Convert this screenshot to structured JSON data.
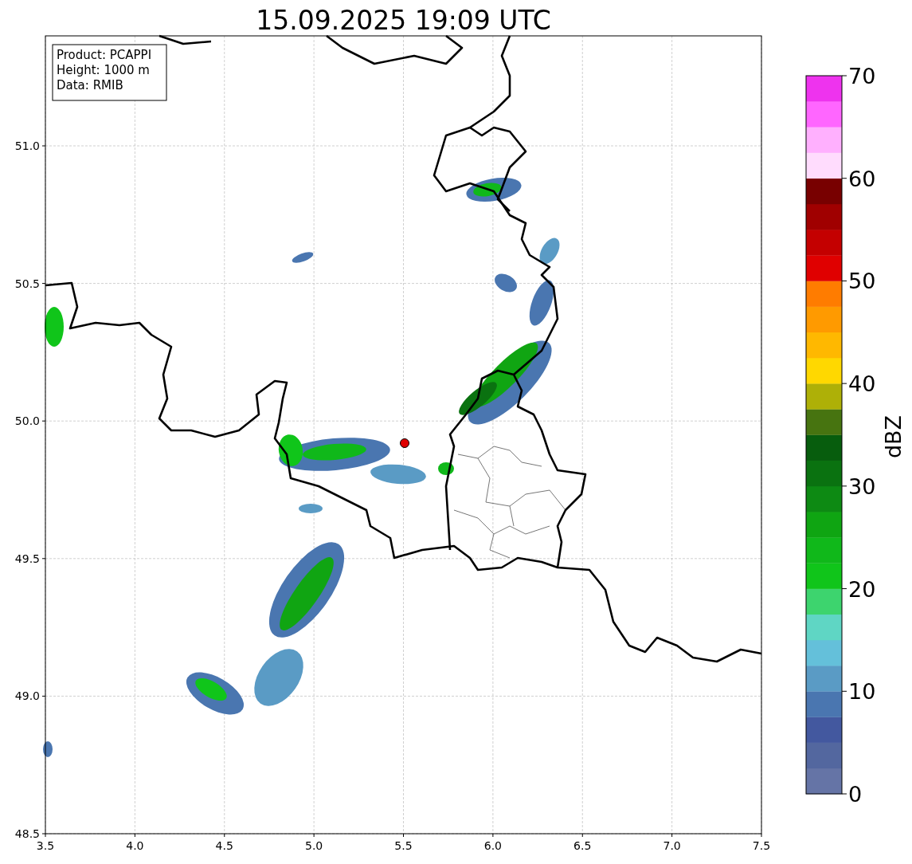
{
  "title": "15.09.2025 19:09 UTC",
  "info_box": [
    "Product: PCAPPI",
    "Height: 1000 m",
    "Data: RMIB"
  ],
  "map": {
    "x_ticks": [
      "3.5",
      "4.0",
      "4.5",
      "5.0",
      "5.5",
      "6.0",
      "6.5",
      "7.0",
      "7.5"
    ],
    "y_ticks": [
      "51.0",
      "50.5",
      "50.0",
      "49.5",
      "49.0",
      "48.5"
    ]
  },
  "colorbar": {
    "label": "dBZ",
    "ticks": [
      "70",
      "60",
      "50",
      "40",
      "30",
      "20",
      "10",
      "0"
    ],
    "bins": [
      {
        "color": "#6574a6"
      },
      {
        "color": "#53679f"
      },
      {
        "color": "#43589f"
      },
      {
        "color": "#4a76b0"
      },
      {
        "color": "#5a9bc5"
      },
      {
        "color": "#64c0da"
      },
      {
        "color": "#5fd6c4"
      },
      {
        "color": "#3dd46e"
      },
      {
        "color": "#10c51a"
      },
      {
        "color": "#10b81a"
      },
      {
        "color": "#0fa512"
      },
      {
        "color": "#0d8a13"
      },
      {
        "color": "#0a7210"
      },
      {
        "color": "#075d0d"
      },
      {
        "color": "#477410"
      },
      {
        "color": "#aeb007"
      },
      {
        "color": "#ffd800"
      },
      {
        "color": "#ffb800"
      },
      {
        "color": "#ff9a00"
      },
      {
        "color": "#ff7c00"
      },
      {
        "color": "#e00000"
      },
      {
        "color": "#c40000"
      },
      {
        "color": "#a00000"
      },
      {
        "color": "#780000"
      },
      {
        "color": "#ffdcfd"
      },
      {
        "color": "#ffb0fe"
      },
      {
        "color": "#ff66ff"
      },
      {
        "color": "#ee33ee"
      }
    ]
  }
}
